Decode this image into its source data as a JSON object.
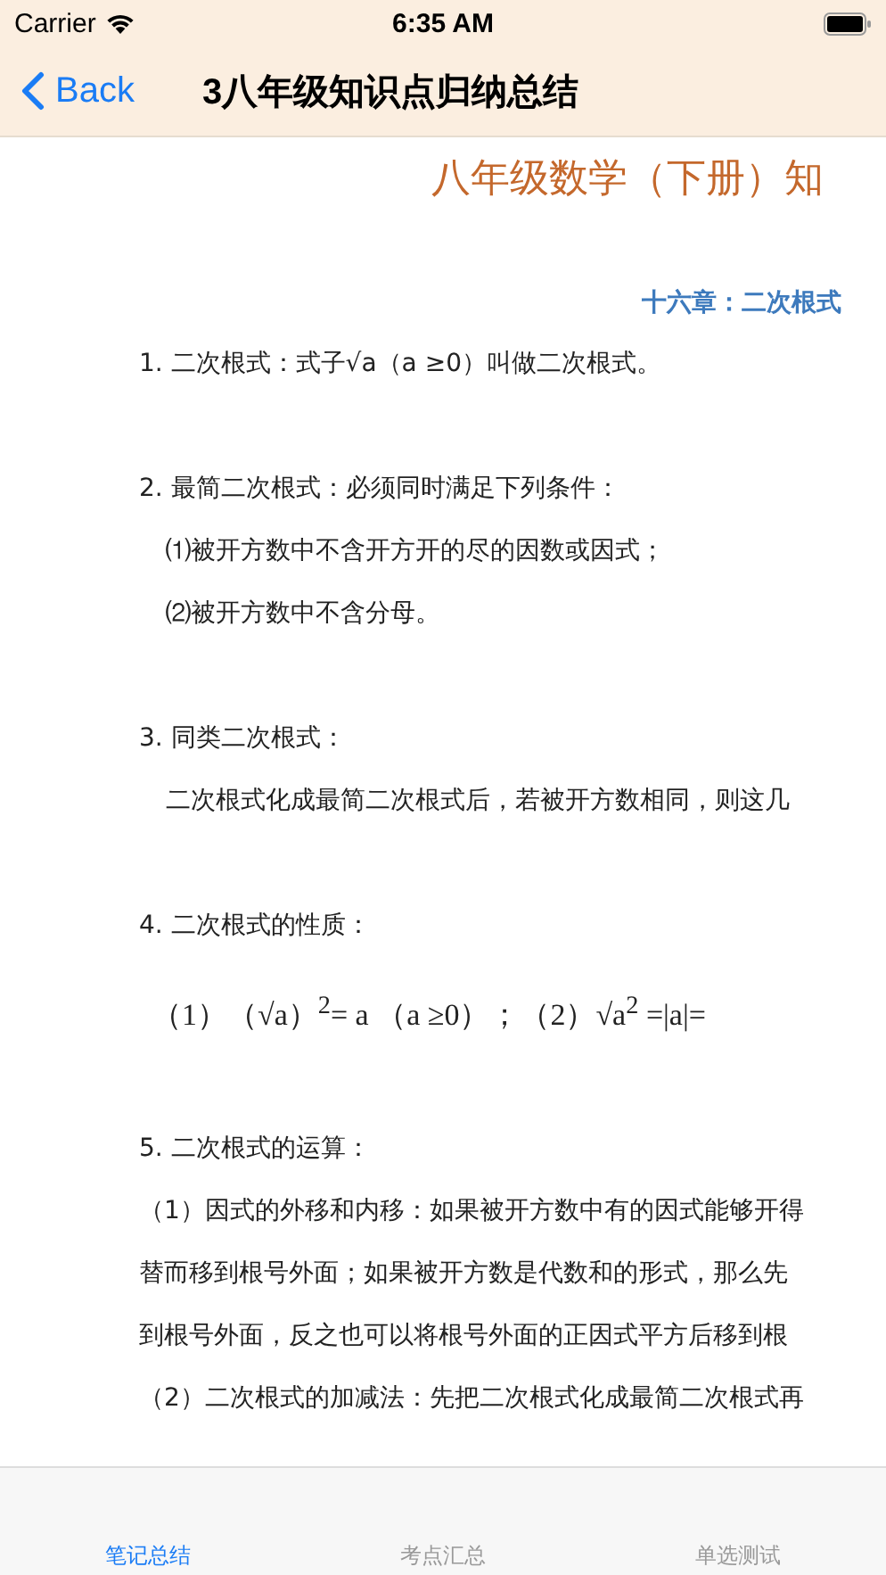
{
  "status_bar": {
    "carrier": "Carrier",
    "time": "6:35 AM"
  },
  "nav_bar": {
    "back": "Back",
    "title": "3八年级知识点归纳总结"
  },
  "document": {
    "title": "八年级数学（下册）知",
    "chapter": "十六章：二次根式",
    "blocks": [
      {
        "kind": "heading",
        "text": "1. 二次根式：式子√a（a ≥0）叫做二次根式。"
      },
      {
        "kind": "heading",
        "text": "2. 最简二次根式：必须同时满足下列条件："
      },
      {
        "kind": "indent",
        "text": "⑴被开方数中不含开方开的尽的因数或因式；"
      },
      {
        "kind": "indent",
        "text": "⑵被开方数中不含分母。"
      },
      {
        "kind": "heading",
        "text": "3. 同类二次根式："
      },
      {
        "kind": "indent",
        "text": "二次根式化成最简二次根式后，若被开方数相同，则这几"
      },
      {
        "kind": "heading",
        "text": "4. 二次根式的性质："
      },
      {
        "kind": "formula",
        "text": "（1）（√a）$^{2}$= a （a ≥0）；（2）√a$^{2}$ =|a|="
      },
      {
        "kind": "heading",
        "text": "5. 二次根式的运算："
      },
      {
        "kind": "para",
        "text": "（1）因式的外移和内移：如果被开方数中有的因式能够开得"
      },
      {
        "kind": "para",
        "text": "替而移到根号外面；如果被开方数是代数和的形式，那么先"
      },
      {
        "kind": "para",
        "text": "到根号外面，反之也可以将根号外面的正因式平方后移到根"
      },
      {
        "kind": "para",
        "text": "（2）二次根式的加减法：先把二次根式化成最简二次根式再"
      }
    ]
  },
  "tab_bar": [
    {
      "label": "笔记总结",
      "selected": true
    },
    {
      "label": "考点汇总",
      "selected": false
    },
    {
      "label": "单选测试",
      "selected": false
    }
  ]
}
